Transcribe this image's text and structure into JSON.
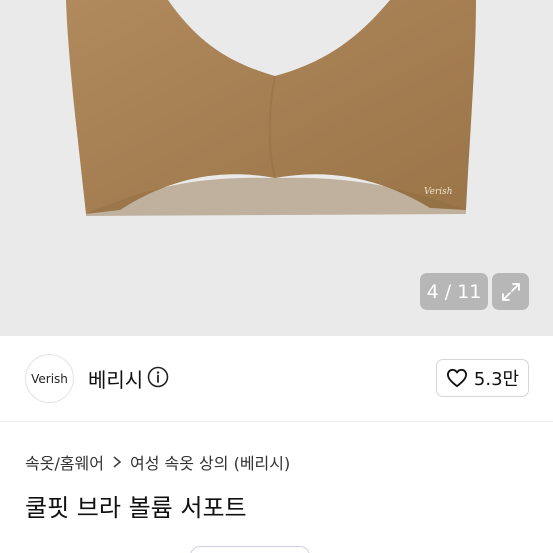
{
  "gallery": {
    "counter": "4 / 11",
    "product_logo": "Verish"
  },
  "seller": {
    "avatar_text": "Verish",
    "name": "베리시",
    "likes": "5.3만"
  },
  "breadcrumb": {
    "category": "속옷/홈웨어",
    "subcategory": "여성 속옷 상의 (베리시)"
  },
  "product": {
    "title": "쿨핏 브라 볼륨 서포트"
  }
}
